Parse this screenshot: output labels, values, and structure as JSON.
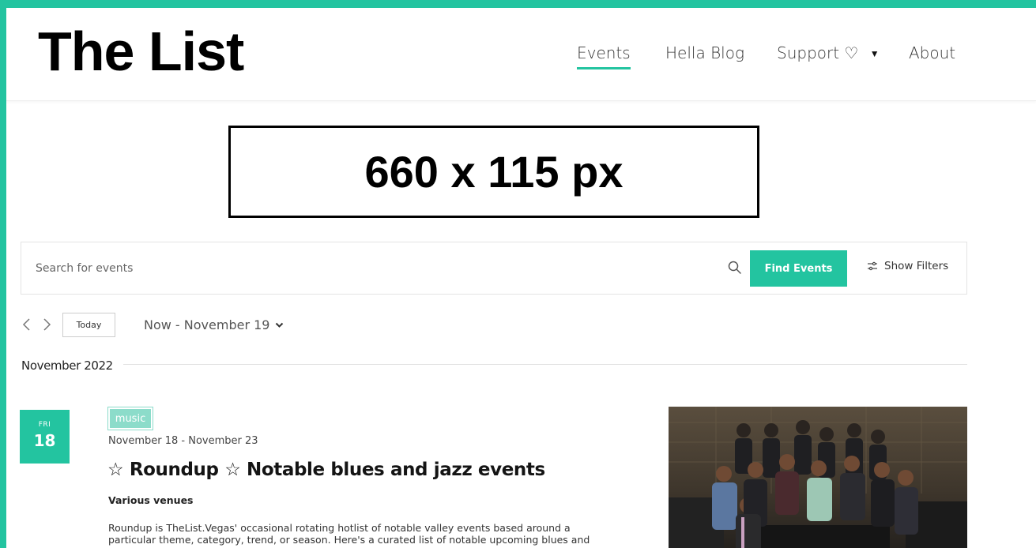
{
  "site": {
    "logo": "The List"
  },
  "nav": {
    "items": [
      {
        "label": "Events",
        "active": true
      },
      {
        "label": "Hella Blog",
        "active": false
      },
      {
        "label": "Support ♡",
        "active": false,
        "has_dropdown": true
      },
      {
        "label": "About",
        "active": false
      }
    ]
  },
  "ad": {
    "label": "660 x 115 px"
  },
  "search": {
    "placeholder": "Search for events",
    "find_label": "Find Events",
    "filters_label": "Show Filters"
  },
  "date_nav": {
    "today_label": "Today",
    "range_label": "Now - November 19"
  },
  "month": {
    "label": "November 2022"
  },
  "event": {
    "day_of_week": "FRI",
    "day_number": "18",
    "category": "music",
    "date_range": "November 18 - November 23",
    "title": "☆ Roundup ☆ Notable blues and jazz events",
    "venue": "Various venues",
    "description": "Roundup is TheList.Vegas' occasional rotating hotlist of notable valley events based around a particular theme, category, trend, or season. Here's a curated list of notable upcoming blues and"
  },
  "colors": {
    "accent": "#23c4a0",
    "tag": "#8cdcca",
    "text": "#141414"
  }
}
